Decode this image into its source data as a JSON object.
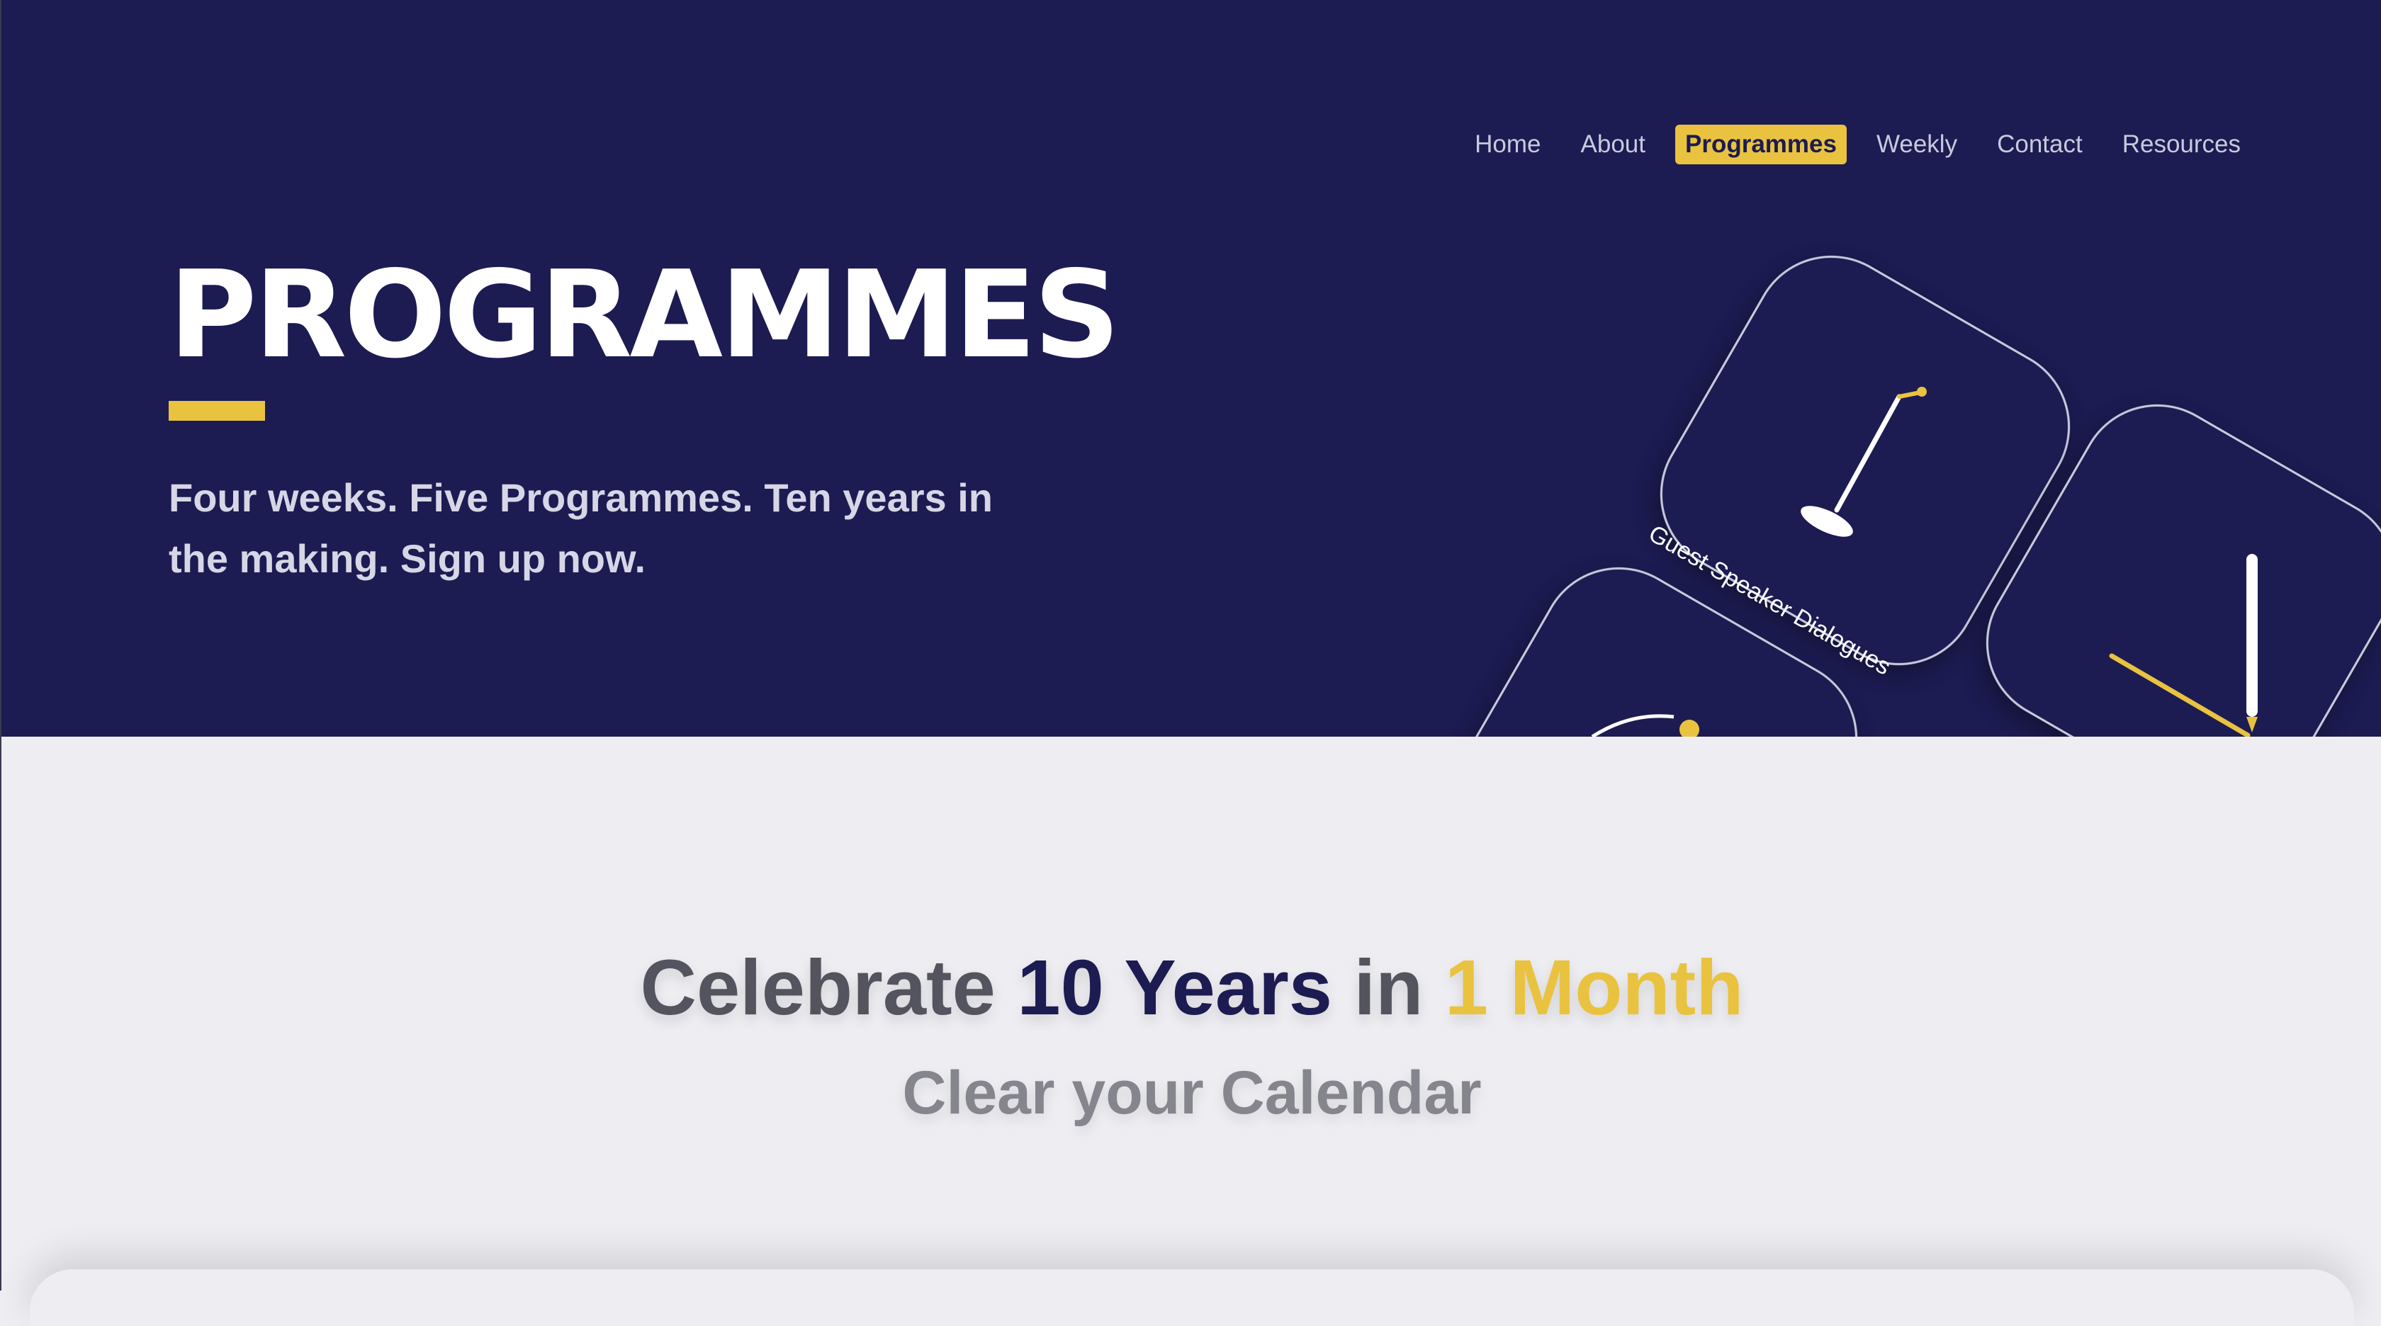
{
  "nav": {
    "items": [
      {
        "label": "Home",
        "name": "nav-home"
      },
      {
        "label": "About",
        "name": "nav-about"
      },
      {
        "label": "Programmes",
        "name": "nav-programmes",
        "active": true
      },
      {
        "label": "Weekly",
        "name": "nav-weekly"
      },
      {
        "label": "Contact",
        "name": "nav-contact"
      },
      {
        "label": "Resources",
        "name": "nav-resources"
      }
    ]
  },
  "hero": {
    "title": "PROGRAMMES",
    "tagline": "Four weeks. Five Programmes. Ten years in the making. Sign up now.",
    "icon_cards": [
      {
        "label": "Guest Speaker Dialogues",
        "icon": "microphone-stand-icon"
      },
      {
        "label": "",
        "icon": "pencil-icon"
      },
      {
        "label": "",
        "icon": "partial-icon"
      }
    ]
  },
  "main": {
    "headline": {
      "part1": "Celebrate ",
      "part2": "10 Years",
      "part3": " in ",
      "part4": "1 Month"
    },
    "subheadline": "Clear your Calendar"
  },
  "colors": {
    "hero_bg": "#1c1b52",
    "accent": "#e9c33f",
    "page_bg": "#eeeef2",
    "text_dark": "#54545e",
    "text_muted": "#85858d"
  }
}
